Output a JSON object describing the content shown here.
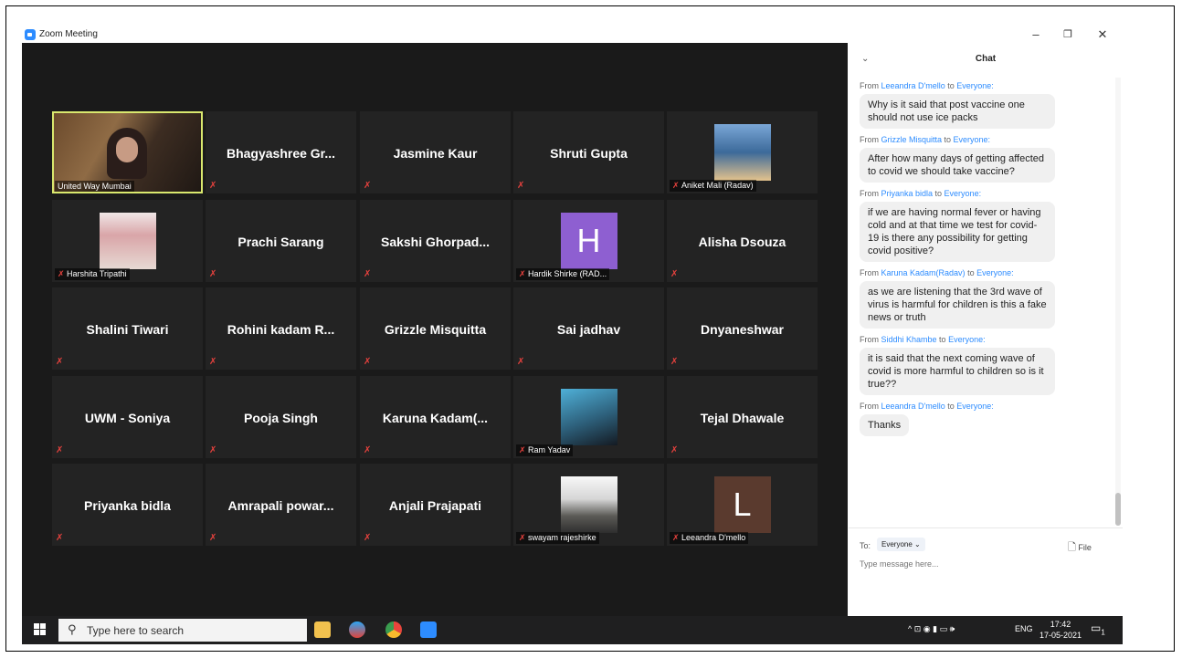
{
  "window": {
    "title": "Zoom Meeting",
    "controls": {
      "minimize": "–",
      "maximize": "❐",
      "close": "✕"
    }
  },
  "colors": {
    "background": "#1a1a1a",
    "tile": "#232323",
    "active_outline": "#d9e86e",
    "muted": "#e5413d",
    "link": "#2d8cff"
  },
  "participants": [
    {
      "name": "United Way Mumbai",
      "type": "camera",
      "label": "United Way Mumbai",
      "active": true
    },
    {
      "name": "Bhagyashree  Gr...",
      "type": "name",
      "muted": true
    },
    {
      "name": "Jasmine Kaur",
      "type": "name",
      "muted": true
    },
    {
      "name": "Shruti Gupta",
      "type": "name",
      "muted": true
    },
    {
      "name": "Aniket Mali (Radav)",
      "type": "picture",
      "label": "Aniket Mali (Radav)",
      "muted": true
    },
    {
      "name": "Harshita Tripathi",
      "type": "picture",
      "label": "Harshita Tripathi",
      "muted": true
    },
    {
      "name": "Prachi Sarang",
      "type": "name",
      "muted": true
    },
    {
      "name": "Sakshi  Ghorpad...",
      "type": "name",
      "muted": true
    },
    {
      "name": "Hardik Shirke (RAD...",
      "type": "letter",
      "letter": "H",
      "avatar_color": "#8e5fd1",
      "label": "Hardik Shirke (RAD...",
      "muted": true
    },
    {
      "name": "Alisha Dsouza",
      "type": "name",
      "muted": true
    },
    {
      "name": "Shalini Tiwari",
      "type": "name",
      "muted": true
    },
    {
      "name": "Rohini  kadam  R...",
      "type": "name",
      "muted": true
    },
    {
      "name": "Grizzle Misquitta",
      "type": "name",
      "muted": true
    },
    {
      "name": "Sai jadhav",
      "type": "name",
      "muted": true
    },
    {
      "name": "Dnyaneshwar",
      "type": "name",
      "muted": true
    },
    {
      "name": "UWM - Soniya",
      "type": "name",
      "muted": true
    },
    {
      "name": "Pooja Singh",
      "type": "name",
      "muted": true
    },
    {
      "name": "Karuna  Kadam(...",
      "type": "name",
      "muted": true
    },
    {
      "name": "Ram Yadav",
      "type": "picture",
      "label": "Ram Yadav",
      "muted": true
    },
    {
      "name": "Tejal Dhawale",
      "type": "name",
      "muted": true
    },
    {
      "name": "Priyanka bidla",
      "type": "name",
      "muted": true
    },
    {
      "name": "Amrapali  powar...",
      "type": "name",
      "muted": true
    },
    {
      "name": "Anjali Prajapati",
      "type": "name",
      "muted": true
    },
    {
      "name": "swayam rajeshirke",
      "type": "picture",
      "label": "swayam rajeshirke",
      "muted": true
    },
    {
      "name": "Leeandra D'mello",
      "type": "letter",
      "letter": "L",
      "avatar_color": "#5a3a2e",
      "label": "Leeandra D'mello",
      "muted": true
    }
  ],
  "chat": {
    "header": "Chat",
    "collapse_icon": "⌄",
    "messages": [
      {
        "from": "Leeandra D'mello",
        "to": "Everyone",
        "text": "Why is it said that post vaccine one should not use ice packs"
      },
      {
        "from": "Grizzle Misquitta",
        "to": "Everyone",
        "text": "After how many days of getting affected to covid we should take vaccine?"
      },
      {
        "from": "Priyanka bidla",
        "to": "Everyone",
        "text": "if we are having normal fever or having cold and at that time we test for covid-19 is there any possibility for getting covid positive?"
      },
      {
        "from": "Karuna Kadam(Radav)",
        "to": "Everyone",
        "text": "as we are listening that the 3rd wave of virus is harmful for children is this a fake news or truth"
      },
      {
        "from": "Siddhi Khambe",
        "to": "Everyone",
        "text": "it is said that the next coming wave of covid is more harmful to children so is it true??"
      },
      {
        "from": "Leeandra D'mello",
        "to": "Everyone",
        "text": "Thanks"
      }
    ],
    "from_prefix": "From",
    "to_word": "to",
    "to_label": "To:",
    "recipient": "Everyone ⌄",
    "file_label": "File",
    "placeholder": "Type message here..."
  },
  "taskbar": {
    "search_placeholder": "Type here to search",
    "language": "ENG",
    "time": "17:42",
    "date": "17-05-2021",
    "tray_icons": "^ ⊡ ◉ ▮ ▭ 🕪",
    "notification_count": "1"
  }
}
